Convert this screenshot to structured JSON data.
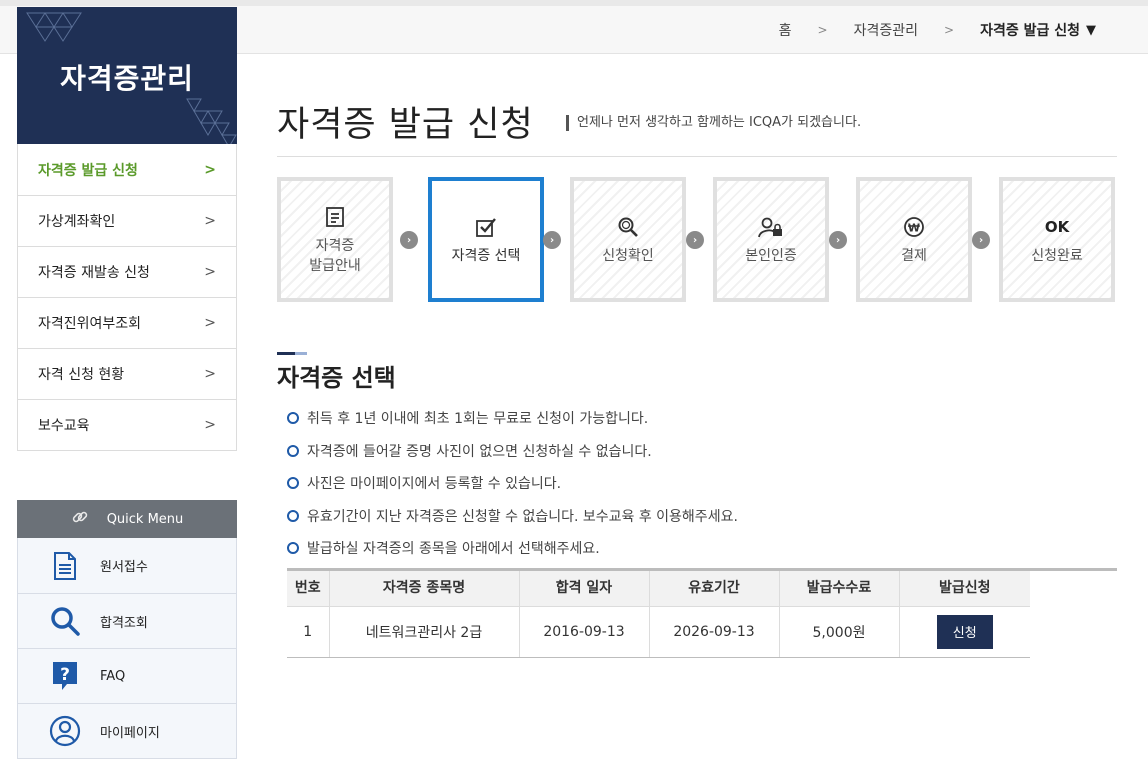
{
  "breadcrumb": {
    "home": "홈",
    "parent": "자격증관리",
    "current": "자격증 발급 신청"
  },
  "sidebar": {
    "title": "자격증관리",
    "items": [
      {
        "label": "자격증 발급 신청",
        "active": true
      },
      {
        "label": "가상계좌확인"
      },
      {
        "label": "자격증 재발송 신청"
      },
      {
        "label": "자격진위여부조회"
      },
      {
        "label": "자격 신청 현황"
      },
      {
        "label": "보수교육"
      }
    ]
  },
  "quick_menu": {
    "title": "Quick Menu",
    "items": [
      {
        "label": "원서접수",
        "icon": "document-icon"
      },
      {
        "label": "합격조회",
        "icon": "search-icon"
      },
      {
        "label": "FAQ",
        "icon": "question-icon"
      },
      {
        "label": "마이페이지",
        "icon": "user-circle-icon"
      }
    ]
  },
  "page": {
    "title": "자격증 발급 신청",
    "subtitle": "언제나 먼저 생각하고 함께하는 ICQA가 되겠습니다."
  },
  "steps": [
    {
      "label": "자격증\n발급안내",
      "icon": "document-icon"
    },
    {
      "label": "자격증 선택",
      "icon": "checkbox-icon",
      "active": true
    },
    {
      "label": "신청확인",
      "icon": "magnifier-icon"
    },
    {
      "label": "본인인증",
      "icon": "user-lock-icon"
    },
    {
      "label": "결제",
      "icon": "won-coin-icon"
    },
    {
      "label": "신청완료",
      "icon": "ok-icon",
      "icon_text": "OK"
    }
  ],
  "section": {
    "title": "자격증 선택",
    "notes": [
      "취득 후 1년 이내에 최초 1회는 무료로 신청이 가능합니다.",
      "자격증에 들어갈 증명 사진이 없으면 신청하실 수 없습니다.",
      "사진은 마이페이지에서 등록할 수 있습니다.",
      "유효기간이 지난 자격증은 신청할 수 없습니다. 보수교육 후 이용해주세요.",
      "발급하실 자격증의 종목을 아래에서 선택해주세요."
    ]
  },
  "table": {
    "headers": [
      "번호",
      "자격증 종목명",
      "합격 일자",
      "유효기간",
      "발급수수료",
      "발급신청"
    ],
    "rows": [
      {
        "no": "1",
        "name": "네트워크관리사 2급",
        "pass_date": "2016-09-13",
        "valid_until": "2026-09-13",
        "fee": "5,000원",
        "button": "신청"
      }
    ]
  },
  "colors": {
    "navy": "#1f3055",
    "active_step": "#1e7fd0",
    "active_menu": "#5a9a2a"
  }
}
